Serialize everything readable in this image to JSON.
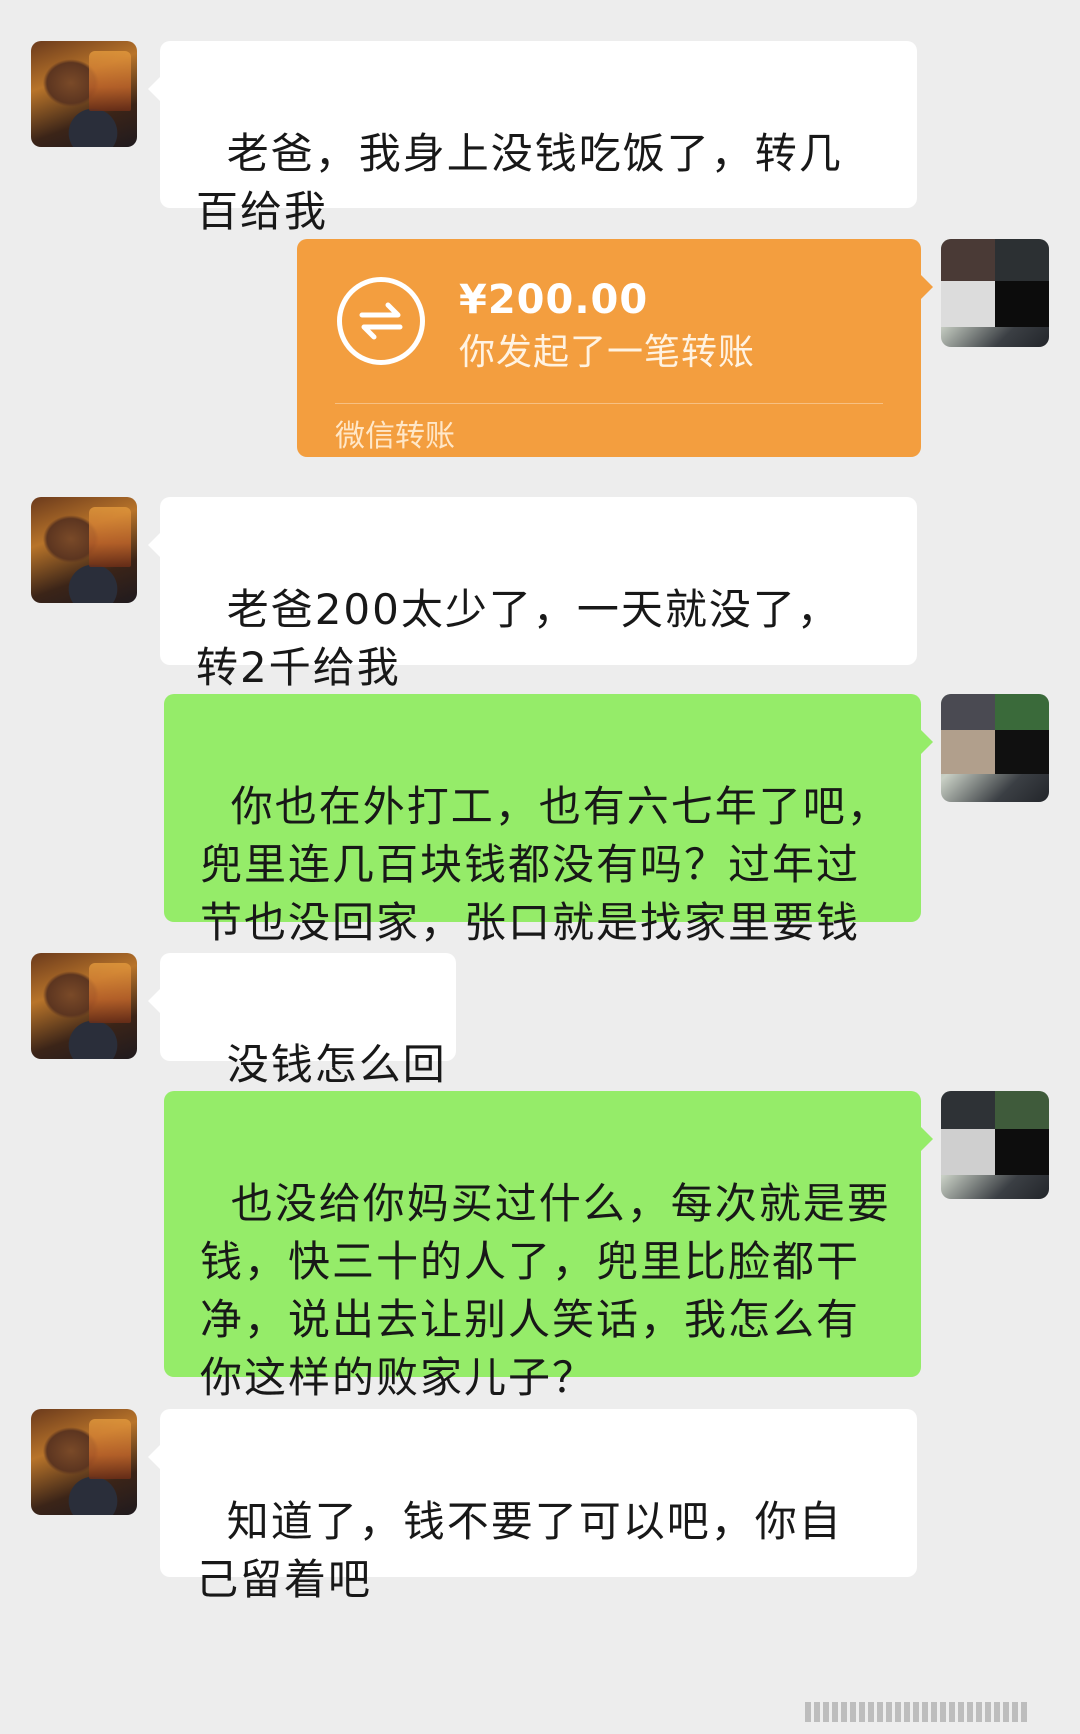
{
  "chat": {
    "messages": [
      {
        "sender": "son",
        "text": "老爸，我身上没钱吃饭了，转几百给我"
      },
      {
        "sender": "dad",
        "type": "transfer",
        "amount": "¥200.00",
        "description": "你发起了一笔转账",
        "footer": "微信转账"
      },
      {
        "sender": "son",
        "text": "老爸200太少了，一天就没了，转2千给我"
      },
      {
        "sender": "dad",
        "text": "你也在外打工，也有六七年了吧，兜里连几百块钱都没有吗？过年过节也没回家，张口就是找家里要钱"
      },
      {
        "sender": "son",
        "text": "没钱怎么回"
      },
      {
        "sender": "dad",
        "text": "也没给你妈买过什么，每次就是要钱，快三十的人了，兜里比脸都干净，说出去让别人笑话，我怎么有你这样的败家儿子？"
      },
      {
        "sender": "son",
        "text": "知道了，钱不要了可以吧，你自己留着吧"
      }
    ]
  },
  "colors": {
    "background": "#ededed",
    "incoming_bubble": "#ffffff",
    "outgoing_bubble": "#95ec69",
    "transfer_card": "#f39e3f"
  },
  "icons": {
    "transfer": "transfer-arrows-icon"
  }
}
